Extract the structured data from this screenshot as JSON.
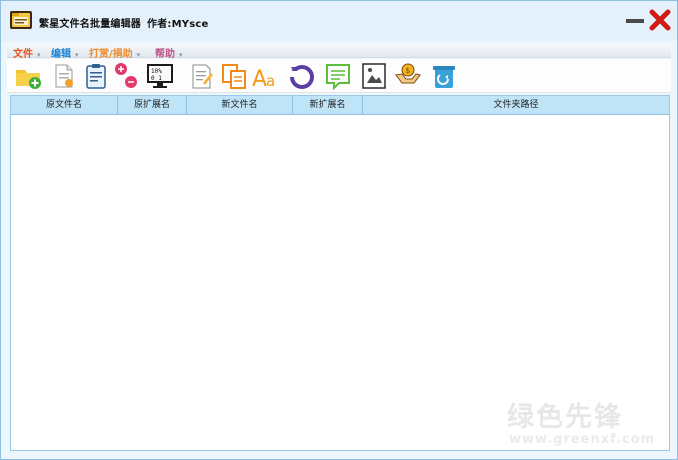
{
  "window": {
    "title": "繁星文件名批量编辑器",
    "author": "作者:MYsce"
  },
  "menu": [
    {
      "label": "文件",
      "color": "#e8541d"
    },
    {
      "label": "编辑",
      "color": "#1e88d8"
    },
    {
      "label": "打赏/捐助",
      "color": "#f28b2c"
    },
    {
      "label": "帮助",
      "color": "#c0508a"
    }
  ],
  "toolbar": [
    {
      "icon": "add-folder-icon"
    },
    {
      "icon": "add-file-icon"
    },
    {
      "icon": "clipboard-icon"
    },
    {
      "icon": "replace-text-icon"
    },
    {
      "icon": "number-sequence-icon"
    },
    {
      "icon": "edit-document-icon"
    },
    {
      "icon": "copy-icon"
    },
    {
      "icon": "font-case-icon"
    },
    {
      "icon": "undo-icon"
    },
    {
      "icon": "message-list-icon"
    },
    {
      "icon": "image-file-icon"
    },
    {
      "icon": "donate-icon"
    },
    {
      "icon": "clear-list-icon"
    }
  ],
  "table": {
    "columns": [
      "原文件名",
      "原扩展名",
      "新文件名",
      "新扩展名",
      "文件夹路径"
    ],
    "rows": []
  },
  "watermark": {
    "text_cn": "绿色先锋",
    "text_en": "www.greenxf.com"
  }
}
